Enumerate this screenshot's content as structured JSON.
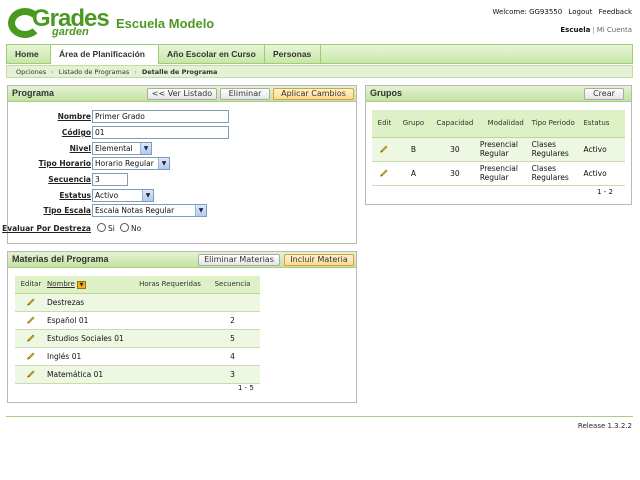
{
  "header": {
    "logo_top": "Grades",
    "logo_bottom": "garden",
    "school": "Escuela Modelo",
    "welcome": "Welcome: GG93550",
    "logout": "Logout",
    "feedback": "Feedback",
    "current_site": "Escuela",
    "account": "Mi Cuenta"
  },
  "nav": {
    "tabs": [
      "Home",
      "Área de Planificación",
      "Año Escolar en Curso",
      "Personas"
    ],
    "active_index": 1
  },
  "breadcrumb": [
    "Opciones",
    "Listado de Programas",
    "Detalle de Programa"
  ],
  "programa": {
    "title": "Programa",
    "btn_back": "<< Ver Listado",
    "btn_delete": "Eliminar",
    "btn_apply": "Aplicar Cambios",
    "labels": {
      "nombre": "Nombre",
      "codigo": "Código",
      "nivel": "Nivel",
      "tipo_horario": "Tipo Horario",
      "secuencia": "Secuencia",
      "estatus": "Estatus",
      "tipo_escala": "Tipo Escala",
      "evaluar": "Evaluar Por Destreza"
    },
    "values": {
      "nombre": "Primer Grado",
      "codigo": "01",
      "nivel": "Elemental",
      "tipo_horario": "Horario Regular",
      "secuencia": "3",
      "estatus": "Activo",
      "tipo_escala": "Escala Notas Regular"
    },
    "radio_si": "Si",
    "radio_no": "No"
  },
  "grupos": {
    "title": "Grupos",
    "btn_create": "Crear",
    "columns": [
      "Edit",
      "Grupo",
      "Capacidad",
      "Modalidad",
      "Tipo Periodo",
      "Estatus"
    ],
    "rows": [
      {
        "grupo": "B",
        "capacidad": "30",
        "modalidad": "Presencial Regular",
        "tipo_periodo": "Clases Regulares",
        "estatus": "Activo"
      },
      {
        "grupo": "A",
        "capacidad": "30",
        "modalidad": "Presencial Regular",
        "tipo_periodo": "Clases Regulares",
        "estatus": "Activo"
      }
    ],
    "pager": "1 - 2"
  },
  "materias": {
    "title": "Materias del Programa",
    "btn_delete": "Eliminar Materias",
    "btn_include": "Incluir Materia",
    "columns": [
      "Editar",
      "Nombre",
      "Horas Requeridas",
      "Secuencia"
    ],
    "rows": [
      {
        "nombre": "Destrezas",
        "horas": "",
        "secuencia": ""
      },
      {
        "nombre": "Español 01",
        "horas": "",
        "secuencia": "2"
      },
      {
        "nombre": "Estudios Sociales 01",
        "horas": "",
        "secuencia": "5"
      },
      {
        "nombre": "Inglés 01",
        "horas": "",
        "secuencia": "4"
      },
      {
        "nombre": "Matemática 01",
        "horas": "",
        "secuencia": "3"
      }
    ],
    "pager": "1 - 5"
  },
  "footer": {
    "release": "Release 1.3.2.2"
  },
  "colors": {
    "brand_green": "#4a9a22",
    "nav_bg": "#c8e6a8",
    "apply_btn": "#ffd890"
  }
}
